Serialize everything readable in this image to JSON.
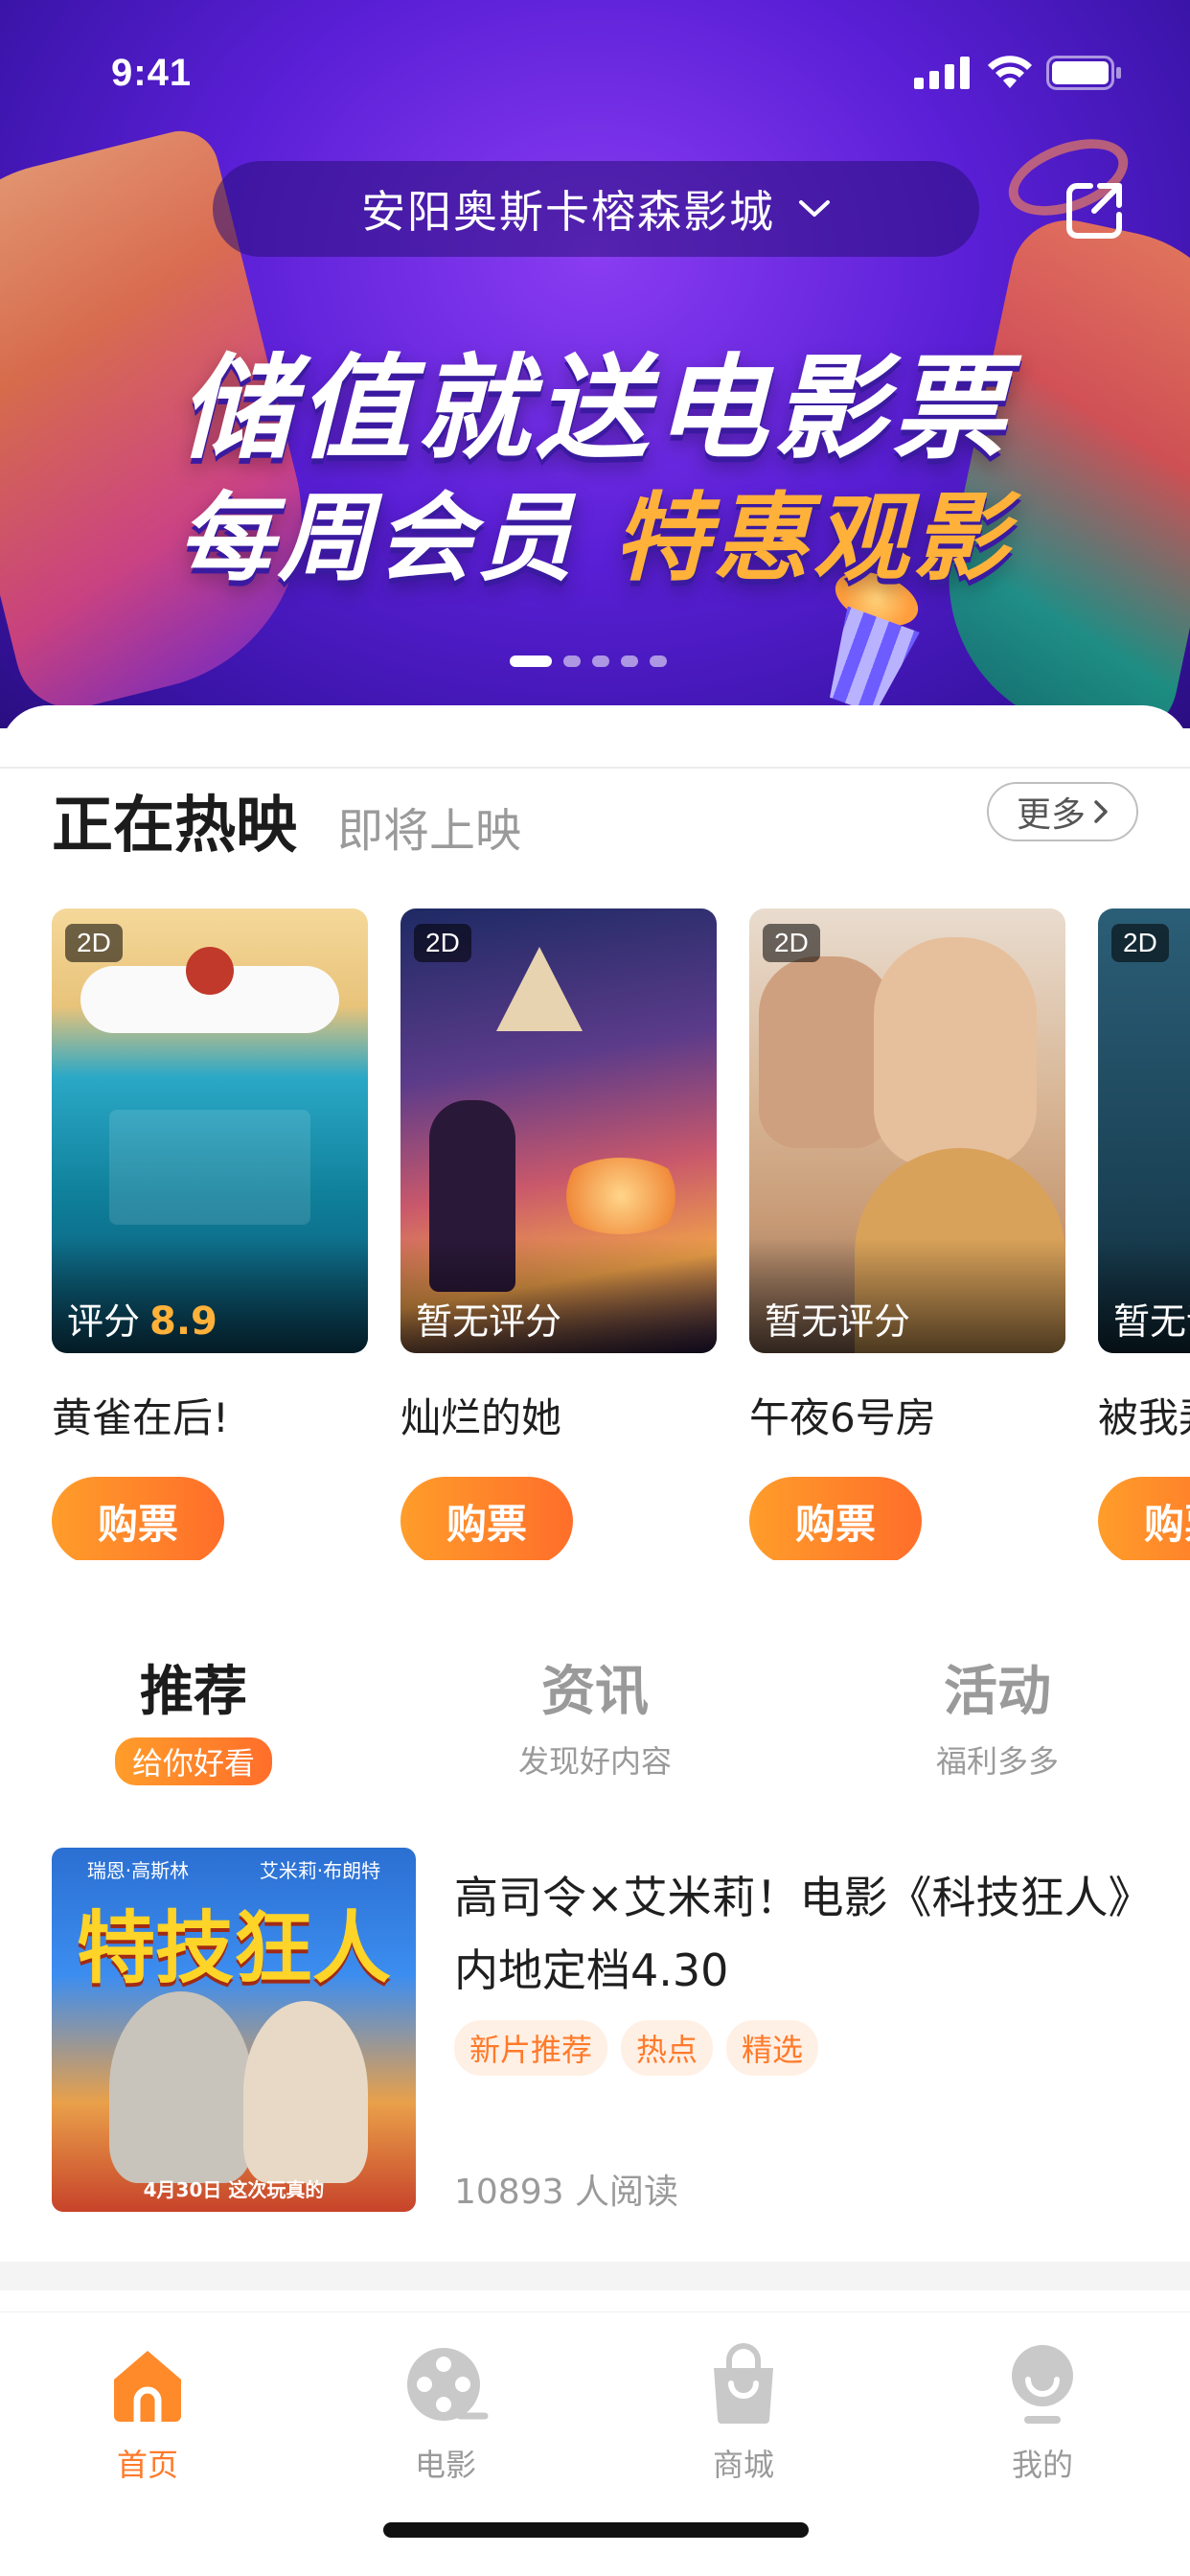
{
  "status_bar": {
    "time": "9:41"
  },
  "header": {
    "cinema_name": "安阳奥斯卡榕森影城"
  },
  "banner": {
    "line1": "储值就送电影票",
    "line2_a": "每周会员",
    "line2_b": "特惠观影",
    "dots": 5,
    "active_dot": 1
  },
  "movies_section": {
    "tab_active": "正在热映",
    "tab_inactive": "即将上映",
    "more_label": "更多"
  },
  "movies": [
    {
      "format": "2D",
      "score_label": "评分",
      "score": "8.9",
      "title": "黄雀在后!",
      "buy_label": "购票"
    },
    {
      "format": "2D",
      "score_label": "暂无评分",
      "score": "",
      "title": "灿烂的她",
      "buy_label": "购票"
    },
    {
      "format": "2D",
      "score_label": "暂无评分",
      "score": "",
      "title": "午夜6号房",
      "buy_label": "购票"
    },
    {
      "format": "2D",
      "score_label": "暂无评分",
      "score": "",
      "title": "被我弄丢的你",
      "buy_label": "购票"
    }
  ],
  "feed_tabs": [
    {
      "label": "推荐",
      "sub": "给你好看",
      "active": true
    },
    {
      "label": "资讯",
      "sub": "发现好内容",
      "active": false
    },
    {
      "label": "活动",
      "sub": "福利多多",
      "active": false
    }
  ],
  "article": {
    "thumb_title": "特技狂人",
    "thumb_cast_left": "瑞恩·高斯林",
    "thumb_cast_right": "艾米莉·布朗特",
    "thumb_date": "4月30日 这次玩真的",
    "title": "高司令×艾米莉！电影《科技狂人》内地定档4.30",
    "tags": [
      "新片推荐",
      "热点",
      "精选"
    ],
    "reads": "10893 人阅读"
  },
  "bottom_nav": [
    {
      "label": "首页",
      "icon": "home-icon",
      "active": true
    },
    {
      "label": "电影",
      "icon": "film-reel-icon",
      "active": false
    },
    {
      "label": "商城",
      "icon": "shopping-bag-icon",
      "active": false
    },
    {
      "label": "我的",
      "icon": "profile-icon",
      "active": false
    }
  ],
  "colors": {
    "accent": "#ff7a2a",
    "accent_light": "#ff9d2a",
    "banner_purple": "#5a1fd6",
    "score_yellow": "#ffb13a"
  }
}
